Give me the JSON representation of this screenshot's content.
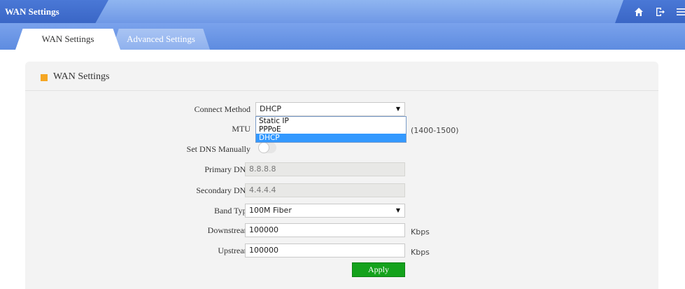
{
  "header": {
    "title": "WAN Settings",
    "icons": [
      "home-icon",
      "logout-icon",
      "menu-icon"
    ]
  },
  "tabs": [
    {
      "label": "WAN Settings",
      "active": true
    },
    {
      "label": "Advanced Settings",
      "active": false
    }
  ],
  "panel": {
    "title": "WAN Settings",
    "accent_color": "#f5a623"
  },
  "form": {
    "connect_method": {
      "label": "Connect Method",
      "value": "DHCP",
      "options": [
        "Static IP",
        "PPPoE",
        "DHCP"
      ],
      "selected_index": 2
    },
    "mtu": {
      "label": "MTU",
      "range": "(1400-1500)"
    },
    "set_dns_manually": {
      "label": "Set DNS Manually",
      "enabled": false
    },
    "primary_dns": {
      "label": "Primary DNS",
      "value": "8.8.8.8"
    },
    "secondary_dns": {
      "label": "Secondary DNS",
      "value": "4.4.4.4"
    },
    "band_type": {
      "label": "Band Type",
      "value": "100M Fiber"
    },
    "downstream": {
      "label": "Downstream",
      "value": "100000",
      "unit": "Kbps"
    },
    "upstream": {
      "label": "Upstream",
      "value": "100000",
      "unit": "Kbps"
    },
    "apply_label": "Apply"
  },
  "colors": {
    "header_blue": "#3a66c6",
    "apply_green": "#14a21c",
    "selection_blue": "#3399ff"
  }
}
